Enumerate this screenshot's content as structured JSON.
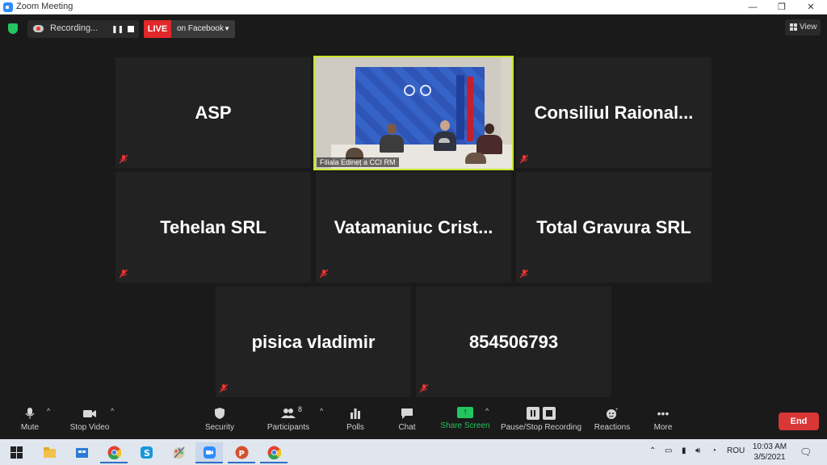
{
  "window": {
    "title": "Zoom Meeting",
    "minimize": "—",
    "restore": "❐",
    "close": "✕"
  },
  "topbar": {
    "recording_label": "Recording...",
    "live_label": "LIVE",
    "live_target": "on Facebook",
    "view_label": "View"
  },
  "participants": [
    {
      "name": "ASP"
    },
    {
      "name": "Filiala Edineț a CCI RM",
      "video": true
    },
    {
      "name": "Consiliul  Raional..."
    },
    {
      "name": "Tehelan SRL"
    },
    {
      "name": "Vatamaniuc  Crist..."
    },
    {
      "name": "Total Gravura SRL"
    },
    {
      "name": "pisica vladimir"
    },
    {
      "name": "854506793"
    }
  ],
  "toolbar": {
    "mute": "Mute",
    "stop_video": "Stop Video",
    "security": "Security",
    "participants": "Participants",
    "participants_count": "8",
    "polls": "Polls",
    "chat": "Chat",
    "share_screen": "Share Screen",
    "pause_stop_recording": "Pause/Stop Recording",
    "reactions": "Reactions",
    "more": "More",
    "end": "End"
  },
  "taskbar": {
    "language": "ROU",
    "time": "10:03 AM",
    "date": "3/5/2021"
  },
  "colors": {
    "active_speaker_border": "#c8e62a",
    "live_red": "#e0282a",
    "share_green": "#23c560",
    "end_red": "#d93636"
  }
}
